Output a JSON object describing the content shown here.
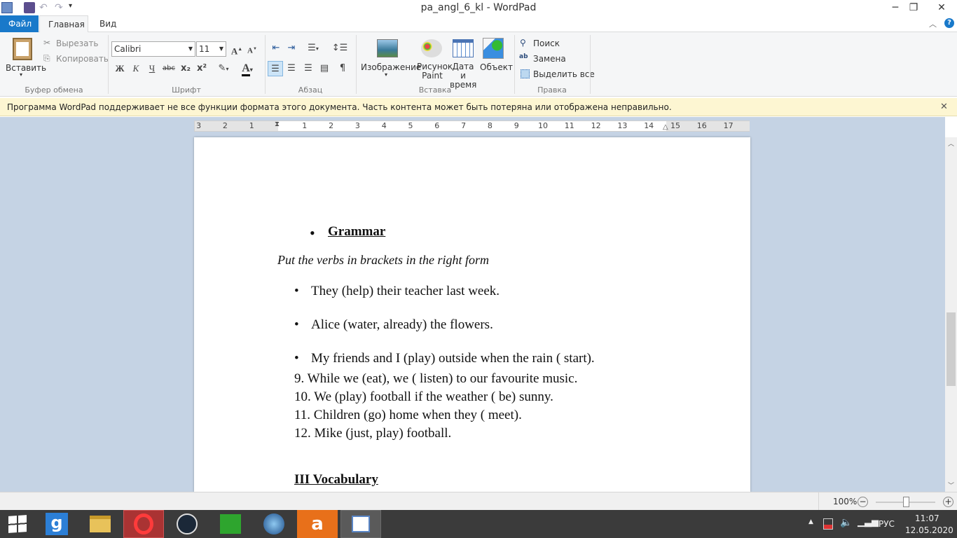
{
  "window": {
    "title": "pa_angl_6_kl - WordPad",
    "minimize": "─",
    "restore": "❐",
    "close": "✕"
  },
  "tabs": {
    "file": "Файл",
    "home": "Главная",
    "view": "Вид"
  },
  "ribbon": {
    "clipboard": {
      "paste": "Вставить",
      "cut": "Вырезать",
      "copy": "Копировать",
      "label": "Буфер обмена"
    },
    "font": {
      "family": "Calibri",
      "size": "11",
      "bold": "Ж",
      "italic": "К",
      "underline": "Ч",
      "strike": "abc",
      "sub": "x₂",
      "sup": "x²",
      "label": "Шрифт"
    },
    "paragraph": {
      "label": "Абзац"
    },
    "insert": {
      "image": "Изображение",
      "paint1": "Рисунок",
      "paint2": "Paint",
      "date1": "Дата и",
      "date2": "время",
      "object": "Объект",
      "label": "Вставка"
    },
    "editing": {
      "find": "Поиск",
      "replace": "Замена",
      "select_all": "Выделить все",
      "label": "Правка"
    }
  },
  "infobar": {
    "text": "Программа WordPad поддерживает не все функции формата этого документа. Часть контента может быть потеряна или отображена неправильно.",
    "close": "✕"
  },
  "ruler": {
    "left": [
      "3",
      "2",
      "1"
    ],
    "right": [
      "1",
      "2",
      "3",
      "4",
      "5",
      "6",
      "7",
      "8",
      "9",
      "10",
      "11",
      "12",
      "13",
      "14",
      "15",
      "16",
      "17"
    ]
  },
  "document": {
    "heading": "Grammar",
    "instruction": "Put the verbs in brackets in the right form",
    "bullets": [
      "They (help) their teacher last week.",
      "Alice (water, already) the flowers.",
      "My friends and I (play) outside when the rain ( start)."
    ],
    "numbered": [
      "9. While we (eat), we ( listen) to our favourite music.",
      "10. We (play) football if the weather ( be) sunny.",
      "11. Children (go) home when they ( meet).",
      "12. Mike (just, play) football."
    ],
    "section": "III  Vocabulary"
  },
  "status": {
    "zoom": "100%",
    "zoom_fraction": 0.5
  },
  "tray": {
    "lang": "РУС",
    "time": "11:07",
    "date": "12.05.2020"
  }
}
